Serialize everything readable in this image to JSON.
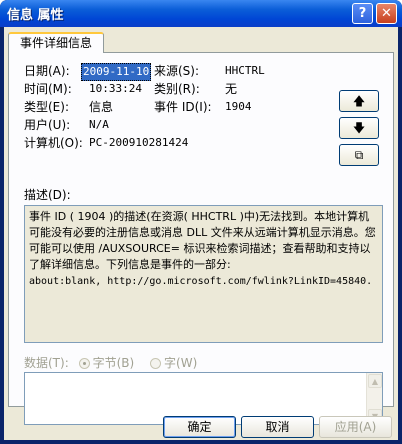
{
  "window": {
    "title": "信息 属性",
    "help_glyph": "?",
    "close_glyph": "✕"
  },
  "tab": {
    "label": "事件详细信息"
  },
  "fields": {
    "date_label": "日期(A):",
    "date_value": "2009-11-10",
    "source_label": "来源(S):",
    "source_value": "HHCTRL",
    "time_label": "时间(M):",
    "time_value": "10:33:24",
    "category_label": "类别(R):",
    "category_value": "无",
    "type_label": "类型(E):",
    "type_value": "信息",
    "event_id_label": "事件 ID(I):",
    "event_id_value": "1904",
    "user_label": "用户(U):",
    "user_value": "N/A",
    "computer_label": "计算机(O):",
    "computer_value": "PC-200910281424"
  },
  "side_buttons": {
    "up_icon": "arrow-up-icon",
    "up_glyph": "🡅",
    "down_icon": "arrow-down-icon",
    "down_glyph": "🡇",
    "copy_icon": "copy-icon",
    "copy_glyph": "⧉"
  },
  "description": {
    "label": "描述(D):",
    "line1": "事件 ID ( 1904 )的描述(在资源( HHCTRL )中)无法找到。本地计算机可能没有必要的注册信息或消息 DLL 文件来从远端计算机显示消息。您可能可以使用 /AUXSOURCE= 标识来检索词描述；查看帮助和支持以了解详细信息。下列信息是事件的一部分:",
    "line2": "about:blank, http://go.microsoft.com/fwlink?LinkID=45840."
  },
  "data": {
    "label": "数据(T):",
    "bytes_label": "字节(B)",
    "words_label": "字(W)",
    "selected": "bytes"
  },
  "buttons": {
    "ok": "确定",
    "cancel": "取消",
    "apply": "应用(A)"
  }
}
